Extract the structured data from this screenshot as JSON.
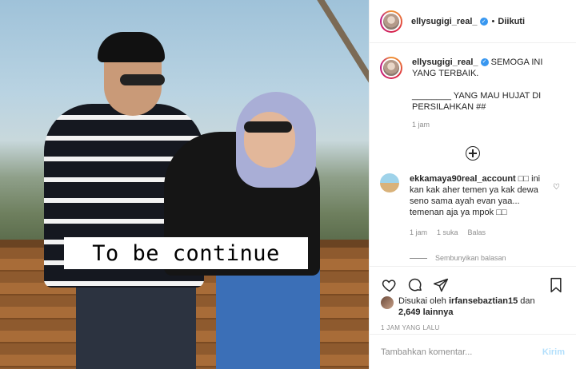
{
  "photo": {
    "overlay_caption": "To be continue"
  },
  "header": {
    "username": "ellysugigi_real_",
    "dot": "•",
    "follow_label": "Diikuti"
  },
  "post": {
    "username": "ellysugigi_real_",
    "text": "SEMOGA INI YANG TERBAIK.\n\n________ YANG MAU HUJAT DI PERSILAHKAN ##",
    "time": "1 jam"
  },
  "comment": {
    "username": "ekkamaya90real_account",
    "text": "□□ ini kan kak aher temen ya kak dewa seno sama ayah evan yaa... temenan aja ya mpok □□",
    "time": "1 jam",
    "likes": "1 suka",
    "reply_label": "Balas",
    "hide_replies": "Sembunyikan balasan"
  },
  "likes": {
    "prefix": "Disukai oleh",
    "user": "irfansebaztian15",
    "and": "dan",
    "others": "2,649 lainnya"
  },
  "post_time": "1 JAM YANG LALU",
  "comment_bar": {
    "placeholder": "Tambahkan komentar...",
    "send_label": "Kirim"
  },
  "colors": {
    "verified": "#3897f0",
    "send_disabled": "#b2dffc",
    "muted": "#8e8e8e"
  }
}
